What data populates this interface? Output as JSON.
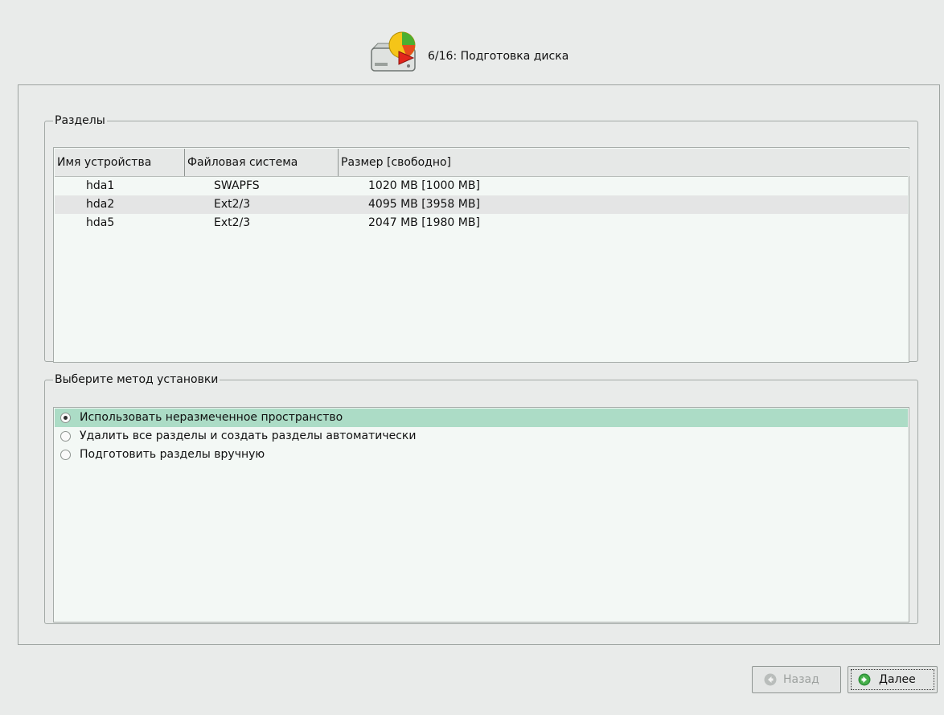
{
  "header": {
    "icon": "disk-pie-icon",
    "title": "6/16: Подготовка диска"
  },
  "partitions": {
    "legend": "Разделы",
    "columns": [
      "Имя устройства",
      "Файловая система",
      "Размер [свободно]"
    ],
    "rows": [
      {
        "device": "hda1",
        "fs": "SWAPFS",
        "size": "1020 MB [1000 MB]"
      },
      {
        "device": "hda2",
        "fs": "Ext2/3",
        "size": "4095 MB [3958 MB]"
      },
      {
        "device": "hda5",
        "fs": "Ext2/3",
        "size": "2047 MB [1980 MB]"
      }
    ]
  },
  "install_method": {
    "legend": "Выберите метод установки",
    "selected_index": 0,
    "options": [
      "Использовать неразмеченное пространство",
      "Удалить все разделы и создать разделы автоматически",
      "Подготовить разделы вручную"
    ]
  },
  "buttons": {
    "back_label": "Назад",
    "back_enabled": false,
    "next_label": "Далее"
  },
  "colors": {
    "selection": "#acdcc6",
    "accent_green": "#3fae3a"
  }
}
